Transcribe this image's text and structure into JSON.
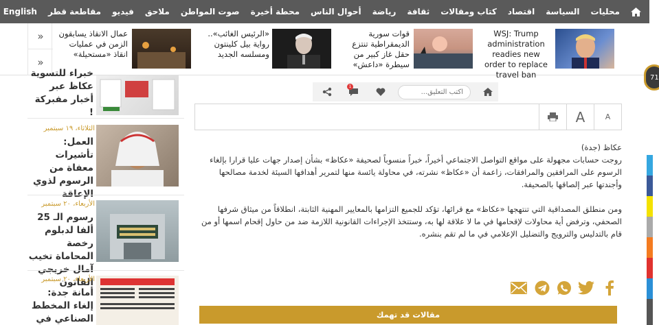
{
  "topnav": {
    "items": [
      "محليات",
      "السياسة",
      "اقتصاد",
      "كتاب ومقالات",
      "ثقافة",
      "رياضة",
      "أحوال الناس",
      "محطة أخيرة",
      "صوت المواطن",
      "ملاحق",
      "فيديو",
      "مقاطعة قطر",
      "English"
    ]
  },
  "ticker": {
    "items": [
      {
        "text": "WSJ: Trump administration readies new order to replace travel ban"
      },
      {
        "text": "قوات سورية الديمقراطية تنتزع حقل غاز كبير من سيطرة «داعش»"
      },
      {
        "text": "«الرئيس الغائب».. رواية بيل كلينتون ومسلسه الجديد"
      },
      {
        "text": "عمال الانقاذ يسابقون الزمن في عمليات انقاذ «مستحيلة»"
      }
    ],
    "arrow_up": "»",
    "arrow_down": "»"
  },
  "progress": {
    "value": "71"
  },
  "sidebar": {
    "items": [
      {
        "date": "",
        "title": "خبراء للتسوية عكاظ عبر أخبار مفبركة !"
      },
      {
        "date": "الثلاثاء، ١٩ سبتمبر",
        "title": "العمل: تأشيرات معفاة من الرسوم لذوي الإعاقة"
      },
      {
        "date": "الأربعاء، ٢٠ سبتمبر",
        "title": "رسوم الـ 25 ألفا لدبلوم رخصة المحاماة تخيب آمال خريجي القانون"
      },
      {
        "date": "الأربعاء، ٢٠ سبتمبر",
        "title": "أمانة جدة: إلغاء المخطط الصناعي في غليل"
      }
    ]
  },
  "tools": {
    "comment_placeholder": "اكتب التعليق...",
    "comment_count": "1"
  },
  "fontbox": {
    "large": "A",
    "small": "A"
  },
  "article": {
    "source": "عكاظ (جدة)",
    "p1": "روجت حسابات مجهولة على مواقع التواصل الاجتماعي أخيراً، خبراً منسوباً لصحيفة «عكاظ» بشأن إصدار جهات عليا قرارا بإلغاء الرسوم على المرافقين والمرافقات، زاعمة أن «عكاظ» نشرته، في محاولة يائسة منها لتمرير أهدافها السيئة لخدمة مصالحها وأجندتها عبر إلصاقها بالصحيفة.",
    "p2": "ومن منطلق المصداقية التي تنتهجها «عكاظ» مع قرائها، تؤكد للجميع التزامها بالمعايير المهنية الثابتة، انطلاقاً من ميثاق شرفها الصحفي، وترفض أية محاولات لإقحامها في ما لا علاقة لها به، وستتخذ الإجراءات القانونية اللازمة ضد من حاول إقحام اسمها أو من قام بالتدليس والترويج والتضليل الإعلامي في ما لم تقم بنشره."
  },
  "related": {
    "label": "مقالات قد تهمك"
  },
  "colors": {
    "nav_bg": "#5a5a5a",
    "accent": "#c99a2c",
    "share_icon": "#d4a53a"
  }
}
